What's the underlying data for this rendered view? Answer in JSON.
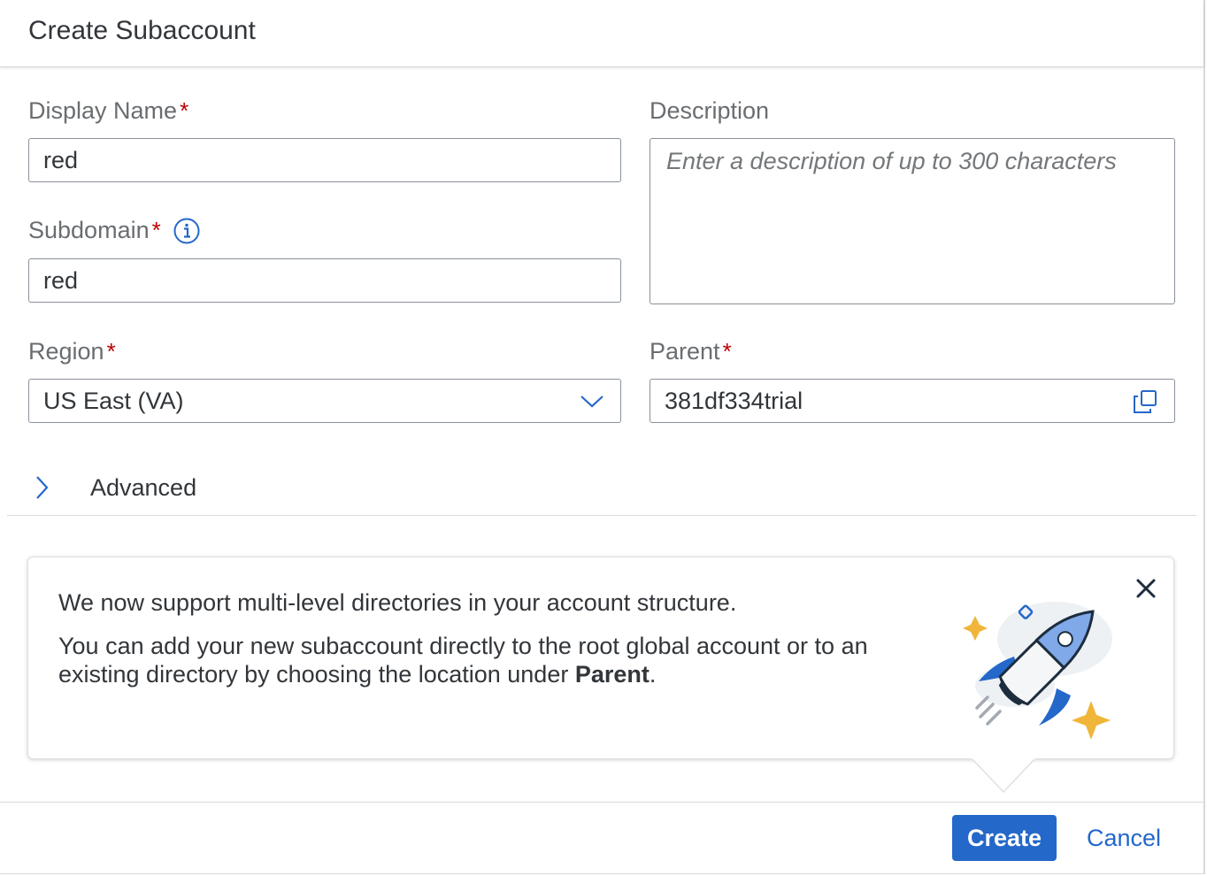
{
  "dialog": {
    "title": "Create Subaccount"
  },
  "form": {
    "display_name": {
      "label": "Display Name",
      "required_mark": "*",
      "value": "red"
    },
    "description": {
      "label": "Description",
      "placeholder": "Enter a description of up to 300 characters"
    },
    "subdomain": {
      "label": "Subdomain",
      "required_mark": "*",
      "value": "red"
    },
    "region": {
      "label": "Region",
      "required_mark": "*",
      "value": "US East (VA)"
    },
    "parent": {
      "label": "Parent",
      "required_mark": "*",
      "value": "381df334trial"
    }
  },
  "advanced": {
    "label": "Advanced"
  },
  "banner": {
    "line1": "We now support multi-level directories in your account structure.",
    "line2_prefix": "You can add your new subaccount directly to the root global account or to an existing directory by choosing the location under ",
    "line2_bold": "Parent",
    "line2_suffix": "."
  },
  "footer": {
    "create_label": "Create",
    "cancel_label": "Cancel"
  },
  "colors": {
    "primary": "#2468c9",
    "required": "#bb0000",
    "border": "#89919a",
    "text": "#32363a",
    "label": "#6a6d70"
  },
  "icons": [
    "info-icon",
    "chevron-down-icon",
    "copy-icon",
    "chevron-right-icon",
    "close-icon",
    "rocket-illustration"
  ]
}
